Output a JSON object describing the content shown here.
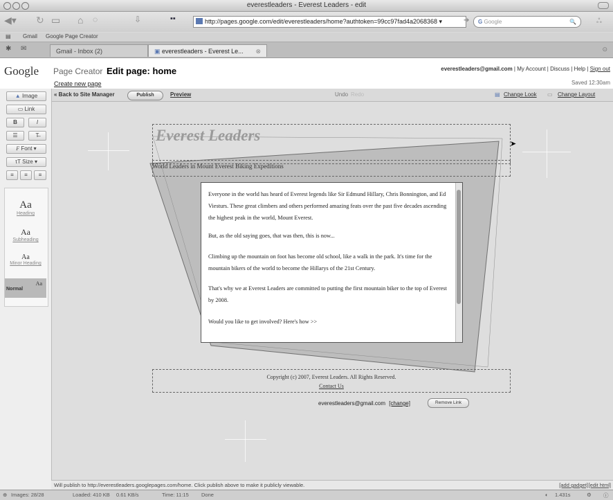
{
  "window": {
    "title": "everestleaders - Everest Leaders - edit"
  },
  "browser": {
    "url": "http://pages.google.com/edit/everestleaders/home?authtoken=99cc97fad4a2068368 ▾",
    "search_placeholder": "Google",
    "bookmarks": [
      "Gmail",
      "Google Page Creator"
    ],
    "tabs": [
      {
        "label": "Gmail - Inbox (2)"
      },
      {
        "label": "everestleaders - Everest Le..."
      }
    ]
  },
  "header": {
    "logo": "Google",
    "product": "Page Creator",
    "edit_label": "Edit page: home",
    "create_new": "Create new page",
    "user_email": "everestleaders@gmail.com",
    "links": [
      "My Account",
      "Discuss",
      "Help",
      "Sign out"
    ],
    "saved": "Saved 12:30am"
  },
  "toolbar": {
    "back": "« Back to Site Manager",
    "publish": "Publish",
    "preview": "Preview",
    "undo": "Undo",
    "redo": "Redo",
    "change_look": "Change Look",
    "change_layout": "Change Layout"
  },
  "left_panel": {
    "image": "Image",
    "link": "Link",
    "bold": "B",
    "italic": "I",
    "font": "Font",
    "size": "Size",
    "styles": [
      {
        "sample": "Aa",
        "name": "Heading"
      },
      {
        "sample": "Aa",
        "name": "Subheading"
      },
      {
        "sample": "Aa",
        "name": "Minor Heading"
      },
      {
        "sample": "Aa",
        "name": "Normal"
      }
    ]
  },
  "page": {
    "title": "Everest Leaders",
    "subtitle": "World Leaders in Mount Everest Biking Expeditions",
    "paragraphs": [
      "Everyone in the world has heard of Everest legends like Sir Edmund Hillary, Chris Bonnington, and Ed Viesturs. These great climbers and others performed amazing feats over the past five decades ascending the highest peak in the world, Mount Everest.",
      "But, as the old saying goes, that was then, this is now...",
      "Climbing up the mountain on foot has become old school, like a walk in the park. It's time for the mountain bikers of the world to become the Hillarys of the 21st Century.",
      "That's why we at Everest Leaders are committed to putting the first mountain biker to the top of Everest by 2008.",
      "Would you like to get involved?  Here's how >>"
    ],
    "copyright": "Copyright (c) 2007, Everest Leaders. All Rights Reserved.",
    "contact": "Contact Us",
    "link_email": "everestleaders@gmail.com",
    "change": "[change]",
    "remove_link": "Remove Link"
  },
  "publish_bar": {
    "message": "Will publish to http://everestleaders.googlepages.com/home. Click publish above to make it publicly viewable.",
    "add_gadget": "[add gadget]",
    "edit_html": "[edit html]"
  },
  "status_bar": {
    "images": "Images: 28/28",
    "loaded": "Loaded: 410 KB",
    "rate": "0.61 KB/s",
    "time": "Time: 11:15",
    "done": "Done",
    "zoom": "1.431s"
  },
  "colors": {
    "accent": "#5b79b2",
    "link": "#222222",
    "canvas": "#dedede"
  }
}
